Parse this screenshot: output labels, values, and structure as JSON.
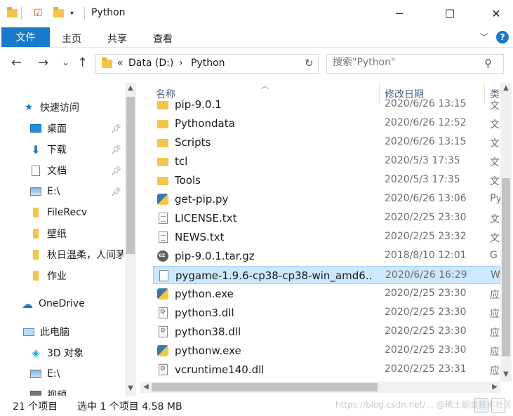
{
  "window": {
    "title": "Python",
    "minimize": "─",
    "maximize": "☐",
    "close": "✕"
  },
  "ribbon": {
    "tabs": [
      "文件",
      "主页",
      "共享",
      "查看"
    ],
    "help": "?"
  },
  "nav": {
    "back": "←",
    "forward": "→",
    "recent": "⌄",
    "up": "↑",
    "address_prefix": "«",
    "address": [
      "Data (D:)",
      "Python"
    ],
    "address_sep": "›",
    "refresh": "↻",
    "search_placeholder": "搜索\"Python\""
  },
  "sidebar": {
    "quick_access": "快速访问",
    "items": [
      {
        "label": "桌面",
        "icon": "desktop-icon",
        "pinned": true
      },
      {
        "label": "下载",
        "icon": "download-icon",
        "pinned": true
      },
      {
        "label": "文档",
        "icon": "document-icon",
        "pinned": true
      },
      {
        "label": "E:\\",
        "icon": "drive-icon",
        "pinned": true
      },
      {
        "label": "FileRecv",
        "icon": "folder-icon",
        "pinned": false
      },
      {
        "label": "壁纸",
        "icon": "folder-icon",
        "pinned": false
      },
      {
        "label": "秋日温柔，人间茅",
        "icon": "folder-icon",
        "pinned": false
      },
      {
        "label": "作业",
        "icon": "folder-icon",
        "pinned": false
      }
    ],
    "onedrive": "OneDrive",
    "this_pc": "此电脑",
    "pc_items": [
      {
        "label": "3D 对象",
        "icon": "3d-objects-icon"
      },
      {
        "label": "E:\\",
        "icon": "drive-icon"
      },
      {
        "label": "视频",
        "icon": "video-icon"
      }
    ]
  },
  "columns": {
    "name": "名称",
    "date": "修改日期",
    "type": "类"
  },
  "files": [
    {
      "name": "pip-9.0.1",
      "date": "2020/6/26 13:15",
      "type": "文",
      "icon": "folder"
    },
    {
      "name": "Pythondata",
      "date": "2020/6/26 12:52",
      "type": "文",
      "icon": "folder"
    },
    {
      "name": "Scripts",
      "date": "2020/6/26 13:15",
      "type": "文",
      "icon": "folder"
    },
    {
      "name": "tcl",
      "date": "2020/5/3 17:35",
      "type": "文",
      "icon": "folder"
    },
    {
      "name": "Tools",
      "date": "2020/5/3 17:35",
      "type": "文",
      "icon": "folder"
    },
    {
      "name": "get-pip.py",
      "date": "2020/6/26 13:06",
      "type": "Py",
      "icon": "py"
    },
    {
      "name": "LICENSE.txt",
      "date": "2020/2/25 23:30",
      "type": "文",
      "icon": "doc"
    },
    {
      "name": "NEWS.txt",
      "date": "2020/2/25 23:32",
      "type": "文",
      "icon": "doc"
    },
    {
      "name": "pip-9.0.1.tar.gz",
      "date": "2018/8/10 12:01",
      "type": "G",
      "icon": "gz"
    },
    {
      "name": "pygame-1.9.6-cp38-cp38-win_amd6...",
      "date": "2020/6/26 16:29",
      "type": "W",
      "icon": "blank",
      "selected": true
    },
    {
      "name": "python.exe",
      "date": "2020/2/25 23:30",
      "type": "应",
      "icon": "py"
    },
    {
      "name": "python3.dll",
      "date": "2020/2/25 23:30",
      "type": "应",
      "icon": "dll"
    },
    {
      "name": "python38.dll",
      "date": "2020/2/25 23:30",
      "type": "应",
      "icon": "dll"
    },
    {
      "name": "pythonw.exe",
      "date": "2020/2/25 23:30",
      "type": "应",
      "icon": "py"
    },
    {
      "name": "vcruntime140.dll",
      "date": "2020/2/25 23:31",
      "type": "应",
      "icon": "dll"
    }
  ],
  "status": {
    "count": "21 个项目",
    "selection": "选中 1 个项目  4.58 MB"
  },
  "watermark": "https://blog.csdn.net/... @稀土掘金技术社区"
}
